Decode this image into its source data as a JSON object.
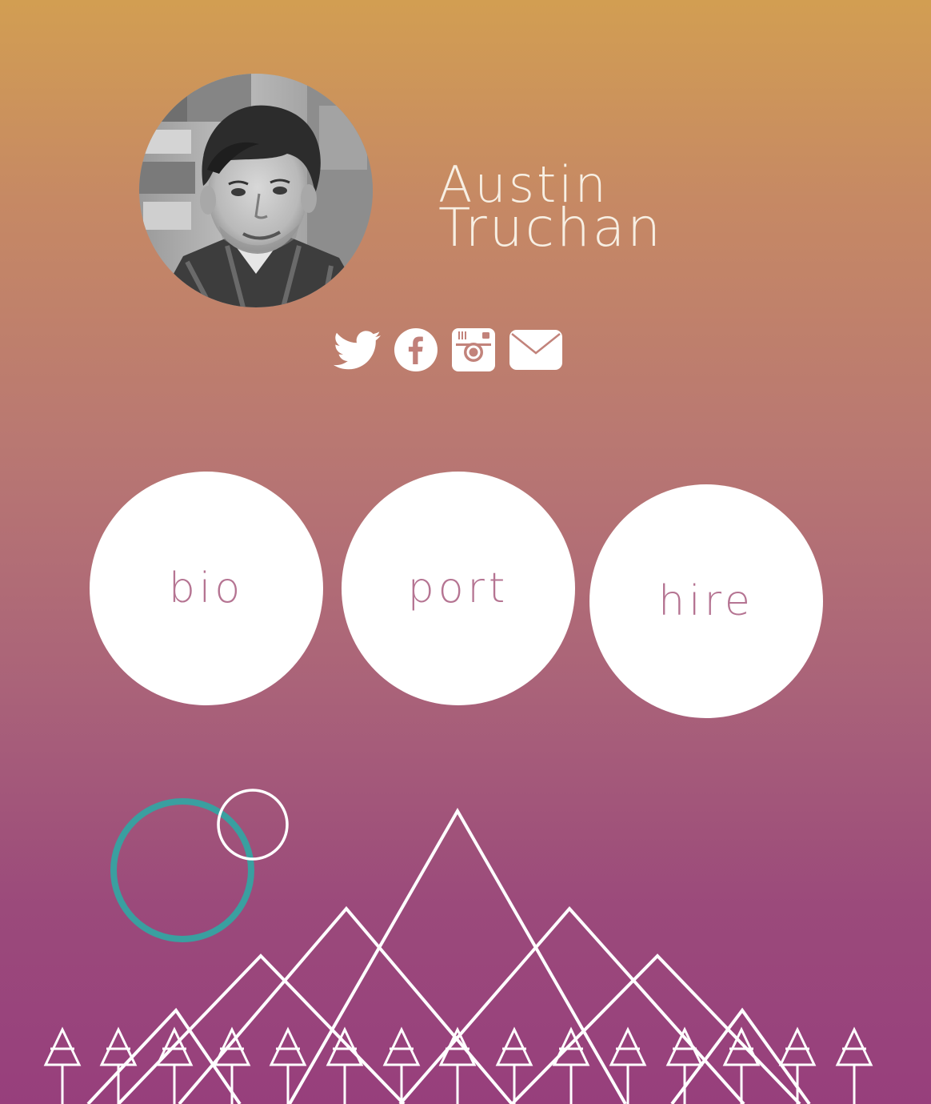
{
  "profile": {
    "first_name": "Austin",
    "last_name": "Truchan",
    "photo_alt": "Austin Truchan profile photo"
  },
  "social": {
    "items": [
      {
        "name": "twitter",
        "icon": "twitter-bird-icon"
      },
      {
        "name": "facebook",
        "icon": "facebook-f-icon"
      },
      {
        "name": "instagram",
        "icon": "instagram-camera-icon"
      },
      {
        "name": "email",
        "icon": "envelope-icon"
      }
    ]
  },
  "nav": {
    "bio_label": "bio",
    "port_label": "port",
    "hire_label": "hire"
  },
  "colors": {
    "gradient_top": "#d29e52",
    "gradient_bottom": "#973f7c",
    "nav_text": "#b57492",
    "teal_ring": "#3a9fa0",
    "line_white": "#ffffff"
  }
}
